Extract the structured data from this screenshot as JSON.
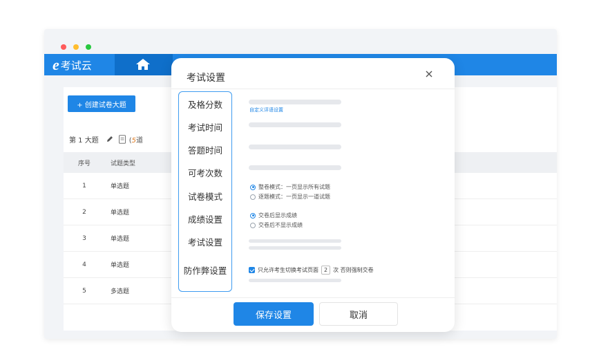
{
  "app": {
    "brand_letter": "e",
    "brand_name": "考试云"
  },
  "content": {
    "create_button_label": "+ 创建试卷大题",
    "section": {
      "title": "第 1 大题",
      "count_number": "5",
      "count_suffix": "道"
    },
    "table": {
      "headers": [
        "序号",
        "试题类型"
      ],
      "rows": [
        {
          "index": "1",
          "type": "单选题"
        },
        {
          "index": "2",
          "type": "单选题"
        },
        {
          "index": "3",
          "type": "单选题"
        },
        {
          "index": "4",
          "type": "单选题"
        },
        {
          "index": "5",
          "type": "多选题"
        }
      ]
    }
  },
  "modal": {
    "title": "考试设置",
    "nav": [
      "及格分数",
      "考试时间",
      "答题时间",
      "可考次数",
      "试卷模式",
      "成绩设置",
      "考试设置",
      "防作弊设置"
    ],
    "custom_link": "自定义评语设置",
    "paper_mode": {
      "options": [
        "整卷模式：一页显示所有试题",
        "逐题模式：一页显示一道试题"
      ],
      "selected_index": 0
    },
    "score_setting": {
      "options": [
        "交卷后显示成绩",
        "交卷后不显示成绩"
      ],
      "selected_index": 0
    },
    "anti_cheat": {
      "checked": true,
      "prefix": "只允许考生切换考试页面",
      "count": "2",
      "suffix": "次 否则强制交卷"
    },
    "save_label": "保存设置",
    "cancel_label": "取消"
  },
  "colors": {
    "primary": "#1f86e6",
    "primary_dark": "#0f6fca",
    "accent_count": "#e07a1f"
  }
}
